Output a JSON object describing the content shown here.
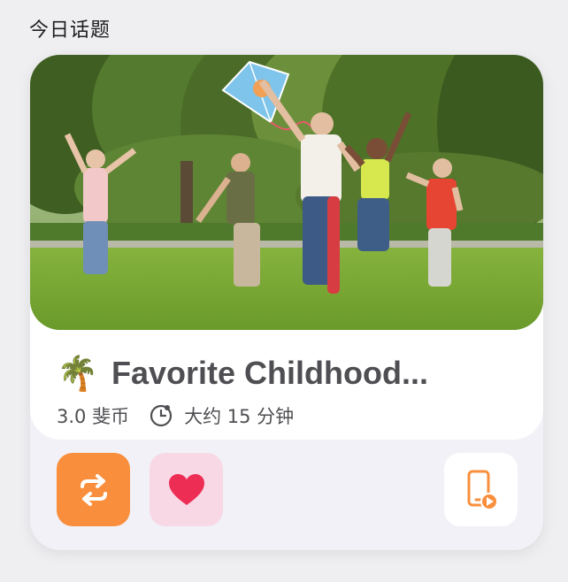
{
  "header": {
    "section_title": "今日话题"
  },
  "topic": {
    "emoji": "🌴",
    "title": "Favorite Childhood...",
    "coins": "3.0 斐币",
    "duration": "大约 15 分钟"
  },
  "icons": {
    "switch": "swap-arrows-icon",
    "like": "heart-icon",
    "video": "phone-play-icon",
    "clock": "clock-icon"
  },
  "colors": {
    "switch_bg": "#f98f3c",
    "like_bg": "#f7d8e4",
    "heart": "#ee2d55",
    "video_icon": "#f98f3c"
  }
}
